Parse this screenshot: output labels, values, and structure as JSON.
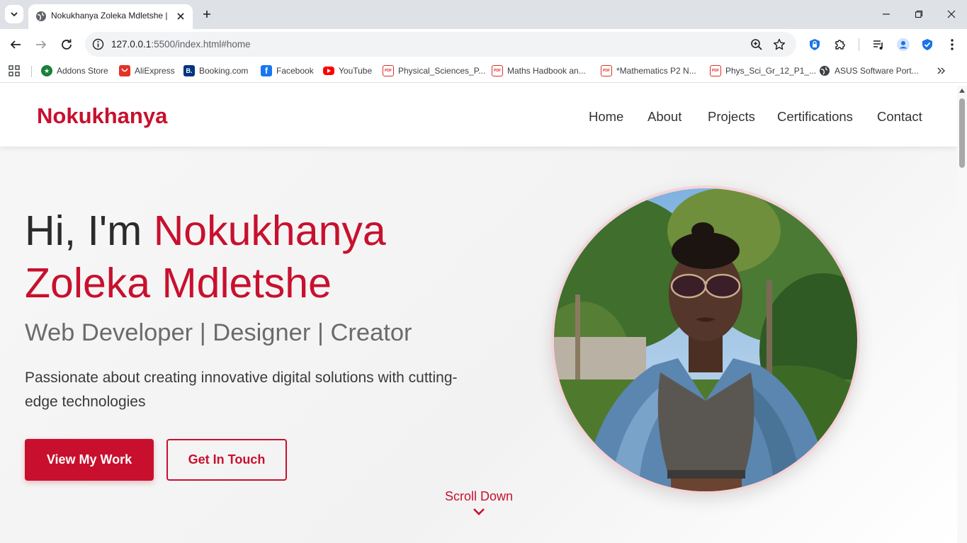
{
  "browser": {
    "tab_title": "Nokukhanya Zoleka Mdletshe |",
    "url_host": "127.0.0.1",
    "url_rest": ":5500/index.html#home",
    "bookmarks": [
      {
        "label": "Addons Store",
        "icon": "addons-store-icon",
        "color": "#188038"
      },
      {
        "label": "AliExpress",
        "icon": "aliexpress-icon",
        "color": "#e43225"
      },
      {
        "label": "Booking.com",
        "icon": "booking-icon",
        "color": "#003580",
        "glyph": "B."
      },
      {
        "label": "Facebook",
        "icon": "facebook-icon",
        "color": "#1877f2",
        "glyph": "f"
      },
      {
        "label": "YouTube",
        "icon": "youtube-icon",
        "color": "#ff0000"
      },
      {
        "label": "Physical_Sciences_P...",
        "icon": "pdf-icon",
        "color": "#d93025",
        "glyph": "PDF"
      },
      {
        "label": "Maths Hadbook an...",
        "icon": "pdf-icon",
        "color": "#d93025",
        "glyph": "PDF"
      },
      {
        "label": "*Mathematics P2 N...",
        "icon": "pdf-icon",
        "color": "#d93025",
        "glyph": "PDF"
      },
      {
        "label": "Phys_Sci_Gr_12_P1_...",
        "icon": "pdf-icon",
        "color": "#d93025",
        "glyph": "PDF"
      },
      {
        "label": "ASUS Software Port...",
        "icon": "asus-globe-icon",
        "color": "#3c4043"
      }
    ]
  },
  "site": {
    "logo": "Nokukhanya",
    "nav": [
      "Home",
      "About",
      "Projects",
      "Certifications",
      "Contact"
    ],
    "hero": {
      "greeting": "Hi, I'm ",
      "name": "Nokukhanya Zoleka Mdletshe",
      "subtitle": "Web Developer | Designer | Creator",
      "description": "Passionate about creating innovative digital solutions with cutting-edge technologies",
      "primary_button": "View My Work",
      "secondary_button": "Get In Touch",
      "scroll_label": "Scroll Down"
    }
  },
  "colors": {
    "accent": "#c8102e",
    "text_dark": "#2b2b2b",
    "text_muted": "#6b6b6b"
  }
}
